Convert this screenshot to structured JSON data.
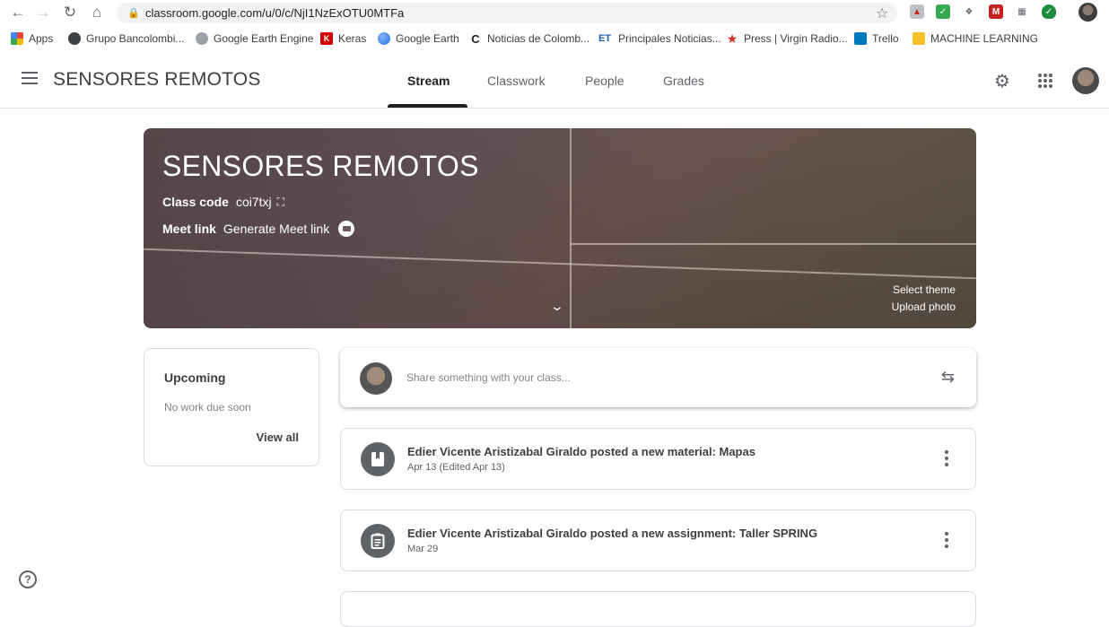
{
  "browser": {
    "url": "classroom.google.com/u/0/c/NjI1NzExOTU0MTFa",
    "bookmarks": [
      {
        "label": "Apps",
        "icon": "apps-grid-icon",
        "color": "#ea4335"
      },
      {
        "label": "Grupo Bancolombi...",
        "icon": "globe-icon",
        "color": "#3c4043"
      },
      {
        "label": "Google Earth Engine",
        "icon": "gear-icon",
        "color": "#5f6368"
      },
      {
        "label": "Keras",
        "icon": "keras-icon",
        "color": "#d00000"
      },
      {
        "label": "Google Earth",
        "icon": "earth-icon",
        "color": "#1a73e8"
      },
      {
        "label": "Noticias de Colomb...",
        "icon": "noticias-icon",
        "color": "#202124"
      },
      {
        "label": "Principales Noticias...",
        "icon": "et-icon",
        "color": "#1a5fb4"
      },
      {
        "label": "Press | Virgin Radio...",
        "icon": "star-icon",
        "color": "#d93025"
      },
      {
        "label": "Trello",
        "icon": "trello-icon",
        "color": "#0079bf"
      },
      {
        "label": "MACHINE LEARNING",
        "icon": "folder-icon",
        "color": "#f6c026"
      }
    ]
  },
  "header": {
    "title": "SENSORES REMOTOS",
    "tabs": [
      {
        "label": "Stream",
        "active": true
      },
      {
        "label": "Classwork",
        "active": false
      },
      {
        "label": "People",
        "active": false
      },
      {
        "label": "Grades",
        "active": false
      }
    ]
  },
  "banner": {
    "title": "SENSORES REMOTOS",
    "class_code_label": "Class code",
    "class_code": "coi7txj",
    "meet_label": "Meet link",
    "meet_value": "Generate Meet link",
    "select_theme": "Select theme",
    "upload_photo": "Upload photo"
  },
  "upcoming": {
    "title": "Upcoming",
    "subtitle": "No work due soon",
    "view_all": "View all"
  },
  "share": {
    "placeholder": "Share something with your class..."
  },
  "posts": [
    {
      "title": "Edier Vicente Aristizabal Giraldo posted a new material: Mapas",
      "date": "Apr 13 (Edited Apr 13)",
      "icon": "book-icon"
    },
    {
      "title": "Edier Vicente Aristizabal Giraldo posted a new assignment: Taller SPRING",
      "date": "Mar 29",
      "icon": "assignment-icon"
    }
  ],
  "help": "?"
}
